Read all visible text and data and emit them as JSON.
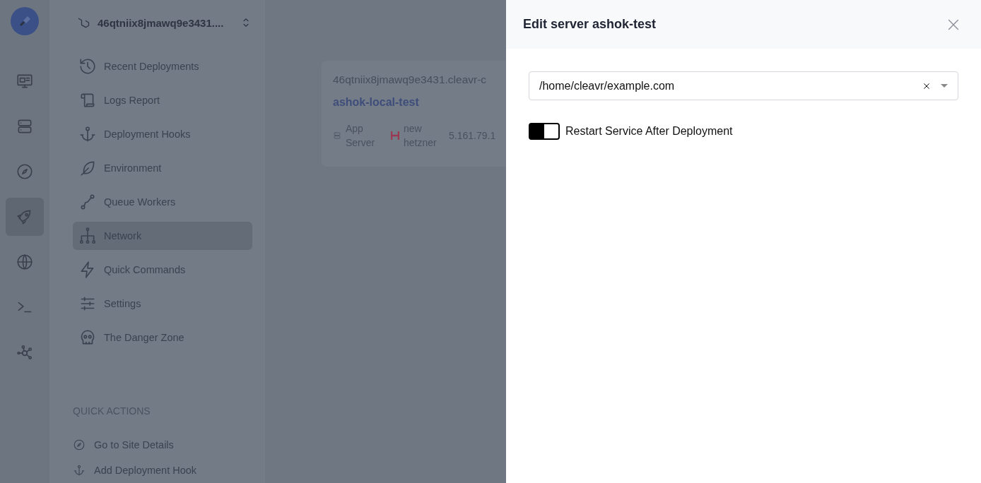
{
  "rail": {
    "items": [
      {
        "selected": false
      },
      {
        "selected": false
      },
      {
        "selected": false
      },
      {
        "selected": true
      },
      {
        "selected": false
      },
      {
        "selected": false
      },
      {
        "selected": false
      }
    ]
  },
  "site_selector": {
    "value": "46qtniix8jmawq9e3431...."
  },
  "sidebar": {
    "items": [
      {
        "label": "Recent Deployments",
        "selected": false
      },
      {
        "label": "Logs Report",
        "selected": false
      },
      {
        "label": "Deployment Hooks",
        "selected": false
      },
      {
        "label": "Environment",
        "selected": false
      },
      {
        "label": "Queue Workers",
        "selected": false
      },
      {
        "label": "Network",
        "selected": true
      },
      {
        "label": "Quick Commands",
        "selected": false
      },
      {
        "label": "Settings",
        "selected": false
      },
      {
        "label": "The Danger Zone",
        "selected": false
      }
    ]
  },
  "quick_actions": {
    "title": "QUICK ACTIONS",
    "items": [
      "Go to Site Details",
      "Add Deployment Hook"
    ]
  },
  "site_card": {
    "domain": "46qtniix8jmawq9e3431.cleavr-c",
    "name": "ashok-local-test",
    "server_type": "App Server",
    "provider": "new hetzner",
    "ip": "5.161.79.1"
  },
  "drawer": {
    "title": "Edit server ashok-test",
    "path_select": {
      "value": "/home/cleavr/example.com"
    },
    "restart_toggle": {
      "label": "Restart Service After Deployment",
      "on": true
    }
  }
}
